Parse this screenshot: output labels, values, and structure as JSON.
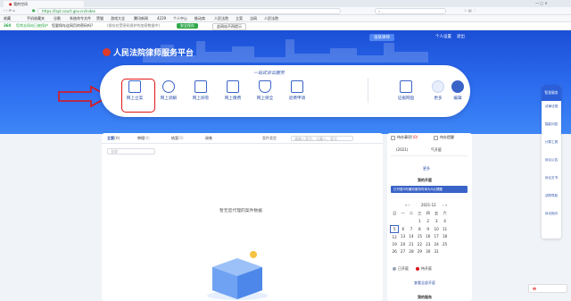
{
  "browser": {
    "tabs": [
      {
        "label": "我的空间"
      }
    ],
    "url": "https://lspt.court.gov.cn/index",
    "search_placeholder": "",
    "bookmarks": [
      "收藏",
      "手机收藏夹",
      "谷歌",
      "系统命令文件",
      "黑猫",
      "游戏大全",
      "腾讯新闻",
      "4229",
      "个人中心",
      "推动商",
      "人民法院",
      "立案",
      "法网",
      "人民法院"
    ],
    "notice_badge": "360",
    "notice_text": "您常去网站已被保护",
    "notice_question": "您要保存这网页的密码吗?",
    "notice_detail": "(保存在受密码保护的加密数据中)",
    "notice_save": "安全保存",
    "notice_never": "此网站不再提示"
  },
  "header": {
    "title": "人民法院律师服务平台",
    "user_badge": "张某律师",
    "personal_settings": "个人设置",
    "logout": "退出"
  },
  "banner_slogan": "一站式诉讼服务",
  "services": [
    {
      "label": "网上立案",
      "icon": "mail-icon"
    },
    {
      "label": "网上调解",
      "icon": "people-icon"
    },
    {
      "label": "网上阅卷",
      "icon": "document-icon"
    },
    {
      "label": "网上缴费",
      "icon": "monitor-icon"
    },
    {
      "label": "网上保全",
      "icon": "shield-icon"
    },
    {
      "label": "退费申请",
      "icon": "refund-icon"
    },
    {
      "label": "证据网盘",
      "icon": "disk-icon"
    },
    {
      "label": "更多",
      "icon": "more-icon"
    },
    {
      "label": "编辑",
      "icon": "edit-icon"
    }
  ],
  "main": {
    "tabs": [
      {
        "label": "立案",
        "count": "(0)"
      },
      {
        "label": "审理",
        "count": "(0)"
      },
      {
        "label": "结案",
        "count": "(0)"
      },
      {
        "label": "阅卷",
        "count": ""
      }
    ],
    "filter_label": "案件类型",
    "search_placeholder": "请输入案号、当事人、案号",
    "select_placeholder": "全部",
    "empty_text": "暂无您代理的案件数据"
  },
  "aside": {
    "todo_label": "待办事项!",
    "todo_count": "(0)",
    "legend_label": "待办提醒",
    "item_year": "(2021)",
    "item_suffix": "气开庭",
    "more": "更多",
    "my_hearings": "我的开庭",
    "hearing_sub": "已开庭5时通知服务时间为9点提醒",
    "month": "2021-12",
    "weekdays": [
      "日",
      "一",
      "二",
      "三",
      "四",
      "五",
      "六"
    ],
    "weeks": [
      [
        "",
        "",
        "",
        "1",
        "2",
        "3",
        "4"
      ],
      [
        "5",
        "6",
        "7",
        "8",
        "9",
        "10",
        "11"
      ],
      [
        "12",
        "13",
        "14",
        "15",
        "16",
        "17",
        "18"
      ],
      [
        "19",
        "20",
        "21",
        "22",
        "23",
        "24",
        "25"
      ],
      [
        "26",
        "27",
        "28",
        "29",
        "30",
        "31",
        ""
      ]
    ],
    "legend_done": "已开庭",
    "legend_pending": "待开庭",
    "view_all": "查看全部开庭",
    "my_service": "我的服务"
  },
  "rightbar": {
    "items": [
      "智慧服务",
      "法律法规",
      "智能问答",
      "计算工具",
      "诉讼公告",
      "诉讼文书",
      "法院导航",
      "诉讼指引"
    ]
  },
  "taskbar": {
    "ime": "中"
  },
  "colors": {
    "hero_start": "#1b4fd6",
    "hero_end": "#3e86f6",
    "accent": "#2a4fa8",
    "highlight": "#e01515",
    "save_green": "#2fa84a"
  }
}
